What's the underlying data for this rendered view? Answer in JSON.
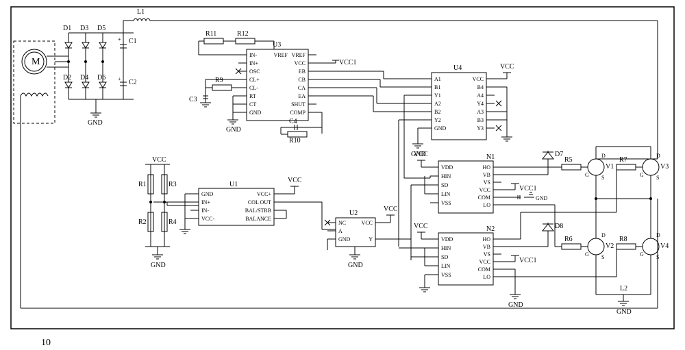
{
  "figure_number": "10",
  "power": {
    "motor_label": "M",
    "inductor": "L1",
    "diodes": [
      "D1",
      "D2",
      "D3",
      "D4",
      "D5",
      "D6"
    ],
    "caps": [
      "C1",
      "C2"
    ],
    "gnd": "GND"
  },
  "comparator": {
    "ref": "U1",
    "vcc_label": "VCC",
    "resistors": [
      "R1",
      "R2",
      "R3",
      "R4"
    ],
    "pins_left": [
      "GND",
      "IN+",
      "IN-",
      "VCC-"
    ],
    "pins_right": [
      "VCC+",
      "COL OUT",
      "BAL/STRB",
      "BALANCE"
    ],
    "gnd": "GND"
  },
  "inverter": {
    "ref": "U2",
    "vcc_label": "VCC",
    "pins_left": [
      "NC",
      "A",
      "GND"
    ],
    "pins_right": [
      "VCC",
      "",
      "Y"
    ],
    "gnd": "GND"
  },
  "pwm": {
    "ref": "U3",
    "vcc_label": "VCC1",
    "resistors": [
      "R11",
      "R12",
      "R9",
      "R10"
    ],
    "caps": [
      "C3",
      "C4"
    ],
    "pins_left": [
      "IN-",
      "IN+",
      "OSC",
      "CL+",
      "CL-",
      "RT",
      "CT",
      "GND"
    ],
    "pins_right": [
      "VREF",
      "VCC",
      "EB",
      "CB",
      "CA",
      "EA",
      "SHUT",
      "COMP"
    ],
    "gnd": "GND"
  },
  "logic": {
    "ref": "U4",
    "vcc_label": "VCC",
    "pins_left": [
      "A1",
      "B1",
      "Y1",
      "A2",
      "B2",
      "Y2",
      "GND"
    ],
    "pins_right": [
      "VCC",
      "B4",
      "A4",
      "Y4",
      "A3",
      "B3",
      "Y3"
    ],
    "gnd": "GND"
  },
  "drivers": {
    "top": {
      "ref": "N1",
      "vcc_label": "VCC",
      "vcc1_label": "VCC1",
      "pins_left": [
        "VDD",
        "HIN",
        "SD",
        "LIN",
        "VSS"
      ],
      "pins_right": [
        "HO",
        "VB",
        "VS",
        "VCC",
        "COM",
        "LO"
      ],
      "diode": "D7",
      "gnd": "GND"
    },
    "bot": {
      "ref": "N2",
      "vcc_label": "VCC",
      "vcc1_label": "VCC1",
      "pins_left": [
        "VDD",
        "HIN",
        "SD",
        "LIN",
        "VSS"
      ],
      "pins_right": [
        "HO",
        "VB",
        "VS",
        "VCC",
        "COM",
        "LO"
      ],
      "diode": "D8",
      "gnd": "GND"
    }
  },
  "bridge": {
    "resistors": [
      "R5",
      "R6",
      "R7",
      "R8"
    ],
    "fets": [
      "V1",
      "V2",
      "V3",
      "V4"
    ],
    "fet_pins": {
      "d": "D",
      "g": "G",
      "s": "S"
    },
    "inductor": "L2",
    "gnd": "GND"
  }
}
